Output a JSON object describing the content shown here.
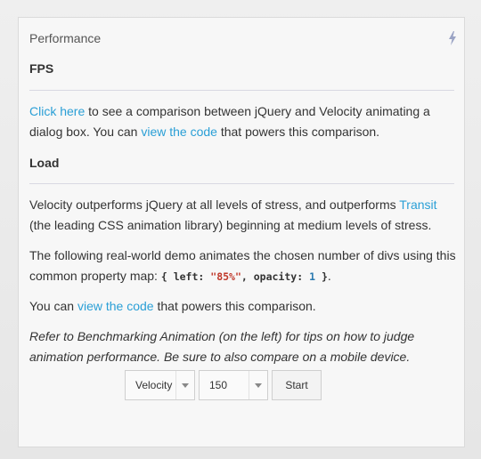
{
  "panel": {
    "title": "Performance",
    "icon": "bolt-icon"
  },
  "fps": {
    "heading": "FPS",
    "link1": "Click here",
    "text1": " to see a comparison between jQuery and Velocity animating a dialog box. You can ",
    "link2": "view the code",
    "text2": " that powers this comparison."
  },
  "load": {
    "heading": "Load",
    "p1_text1": "Velocity outperforms jQuery at all levels of stress, and outperforms ",
    "p1_link": "Transit",
    "p1_text2": " (the leading CSS animation library) beginning at medium levels of stress.",
    "p2_text": "The following real-world demo animates the chosen number of divs using this common property map: ",
    "code": {
      "open": "{ ",
      "key1": "left",
      "colon1": ": ",
      "val1": "\"85%\"",
      "comma": ", ",
      "key2": "opacity",
      "colon2": ": ",
      "val2": "1",
      "close": " }"
    },
    "p2_end": ".",
    "p3_text1": "You can ",
    "p3_link": "view the code",
    "p3_text2": " that powers this comparison.",
    "note": "Refer to Benchmarking Animation (on the left) for tips on how to judge animation performance. Be sure to also compare on a mobile device."
  },
  "controls": {
    "engine_value": "Velocity",
    "count_value": "150",
    "start_label": "Start"
  }
}
